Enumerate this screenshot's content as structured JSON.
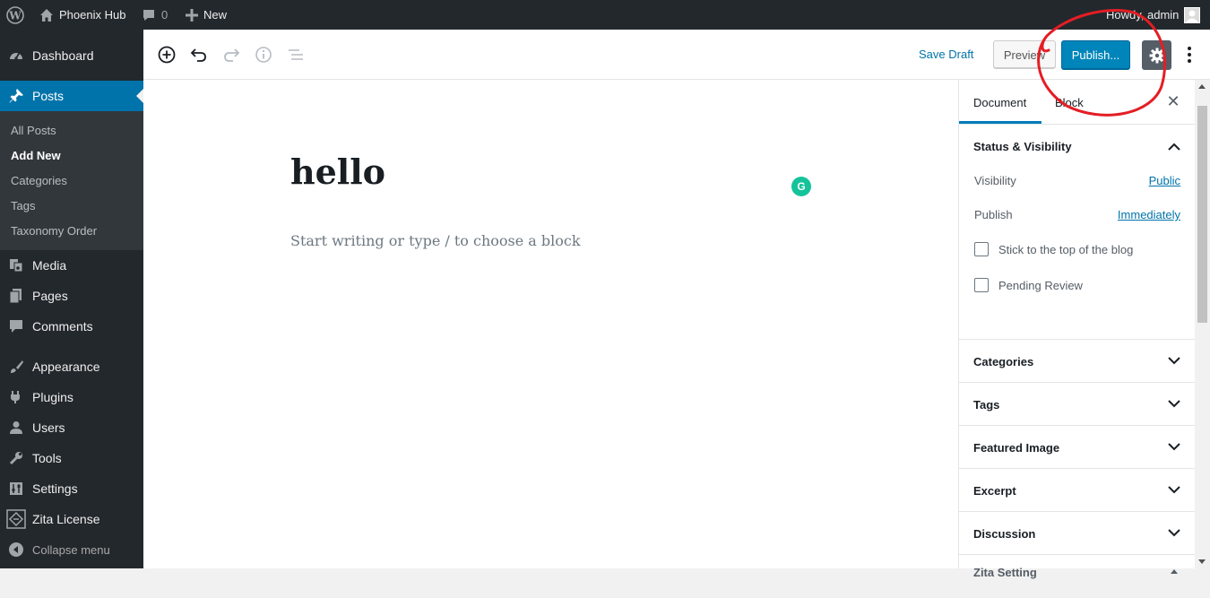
{
  "adminbar": {
    "site_name": "Phoenix Hub",
    "comments_count": "0",
    "new_label": "New",
    "greeting": "Howdy, admin"
  },
  "sidebar": {
    "items": [
      {
        "label": "Dashboard",
        "icon": "dashboard-icon"
      },
      {
        "label": "Posts",
        "icon": "pin-icon"
      },
      {
        "label": "Media",
        "icon": "media-icon"
      },
      {
        "label": "Pages",
        "icon": "pages-icon"
      },
      {
        "label": "Comments",
        "icon": "comments-icon"
      },
      {
        "label": "Appearance",
        "icon": "appearance-icon"
      },
      {
        "label": "Plugins",
        "icon": "plugins-icon"
      },
      {
        "label": "Users",
        "icon": "users-icon"
      },
      {
        "label": "Tools",
        "icon": "tools-icon"
      },
      {
        "label": "Settings",
        "icon": "settings-icon"
      },
      {
        "label": "Zita License",
        "icon": "zita-icon"
      }
    ],
    "posts_submenu": [
      "All Posts",
      "Add New",
      "Categories",
      "Tags",
      "Taxonomy Order"
    ],
    "collapse_label": "Collapse menu",
    "accent": "#0073aa"
  },
  "toolbar": {
    "save_draft": "Save Draft",
    "preview": "Preview",
    "publish": "Publish..."
  },
  "post": {
    "title": "hello",
    "placeholder": "Start writing or type / to choose a block"
  },
  "settings_panel": {
    "tabs": [
      "Document",
      "Block"
    ],
    "status": {
      "title": "Status & Visibility",
      "visibility_label": "Visibility",
      "visibility_value": "Public",
      "publish_label": "Publish",
      "publish_value": "Immediately",
      "sticky_label": "Stick to the top of the blog",
      "pending_label": "Pending Review"
    },
    "sections": [
      "Categories",
      "Tags",
      "Featured Image",
      "Excerpt",
      "Discussion",
      "Zita Setting"
    ]
  }
}
